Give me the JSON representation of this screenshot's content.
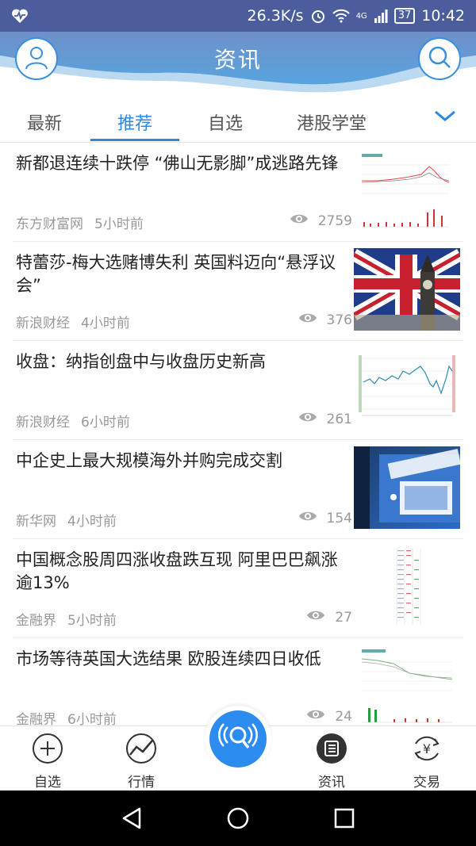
{
  "status_bar": {
    "speed": "26.3K/s",
    "network": "4G",
    "battery": "37",
    "time": "10:42"
  },
  "header": {
    "title": "资讯"
  },
  "tabs": [
    {
      "label": "最新"
    },
    {
      "label": "推荐"
    },
    {
      "label": "自选"
    },
    {
      "label": "港股学堂"
    }
  ],
  "news": [
    {
      "title": "新都退连续十跌停 “佛山无影脚”成逃路先锋",
      "source": "东方财富网",
      "time": "5小时前",
      "views": "2759",
      "thumb": "stock-chart"
    },
    {
      "title": "特蕾莎-梅大选赌博失利 英国料迈向“悬浮议会”",
      "source": "新浪财经",
      "time": "4小时前",
      "views": "376",
      "thumb": "uk-flag-big-ben"
    },
    {
      "title": "收盘：纳指创盘中与收盘历史新高",
      "source": "新浪财经",
      "time": "6小时前",
      "views": "261",
      "thumb": "line-chart"
    },
    {
      "title": "中企史上最大规模海外并购完成交割",
      "source": "新华网",
      "time": "4小时前",
      "views": "154",
      "thumb": "syngenta-sign"
    },
    {
      "title": "中国概念股周四涨收盘跌互现 阿里巴巴飙涨逾13%",
      "source": "金融界",
      "time": "5小时前",
      "views": "27",
      "thumb": "data-table"
    },
    {
      "title": "市场等待英国大选结果 欧股连续四日收低",
      "source": "金融界",
      "time": "6小时前",
      "views": "24",
      "thumb": "stock-chart"
    }
  ],
  "bottom_nav": [
    {
      "label": "自选",
      "icon": "plus-circle-icon"
    },
    {
      "label": "行情",
      "icon": "trend-chart-icon"
    },
    {
      "label": "资讯",
      "icon": "news-icon"
    },
    {
      "label": "交易",
      "icon": "yuan-exchange-icon"
    }
  ],
  "colors": {
    "status_bar": "#4b5d9c",
    "accent": "#2f88e0",
    "header_wave": "#5a86c9"
  }
}
